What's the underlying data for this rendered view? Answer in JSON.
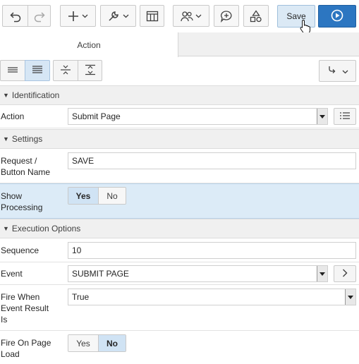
{
  "toolbar": {
    "undo_icon": "undo-icon",
    "redo_icon": "redo-icon",
    "create_icon": "plus-icon",
    "utilities_icon": "wrench-icon",
    "layout_icon": "page-layout-icon",
    "shared_components_icon": "users-icon",
    "comments_icon": "comment-plus-icon",
    "shapes_icon": "shapes-icon",
    "save_label": "Save",
    "run_icon": "play-circle-icon",
    "accent_color": "#2c76c1"
  },
  "tabs": [
    {
      "label": "Action",
      "active": true
    }
  ],
  "layout_toggles": {
    "compact_icon": "rows-compact-icon",
    "comfortable_icon": "rows-comfortable-icon",
    "collapse_all_icon": "collapse-all-icon",
    "expand_all_icon": "expand-all-icon",
    "goto_group_icon": "goto-arrow-icon"
  },
  "sections": {
    "identification": "Identification",
    "settings": "Settings",
    "execution_options": "Execution Options"
  },
  "properties": {
    "action": {
      "label": "Action",
      "value": "Submit Page"
    },
    "request": {
      "label_line1": "Request /",
      "label_line2": "Button Name",
      "value": "SAVE"
    },
    "show_processing": {
      "label_line1": "Show",
      "label_line2": "Processing",
      "options": [
        "Yes",
        "No"
      ],
      "selected": "Yes"
    },
    "sequence": {
      "label": "Sequence",
      "value": "10"
    },
    "event": {
      "label": "Event",
      "value": "SUBMIT PAGE"
    },
    "fire_when": {
      "label_line1": "Fire When",
      "label_line2": "Event Result",
      "label_line3": "Is",
      "value": "True"
    },
    "fire_on_page_load": {
      "label_line1": "Fire On Page",
      "label_line2": "Load",
      "options": [
        "Yes",
        "No"
      ],
      "selected": "No"
    }
  }
}
